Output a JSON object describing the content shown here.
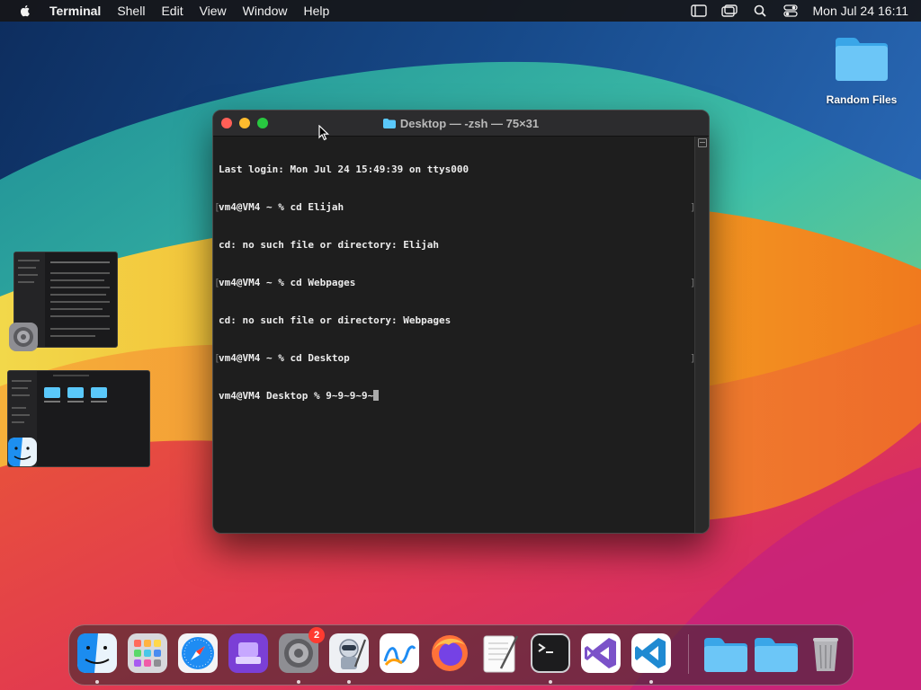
{
  "menubar": {
    "app_name": "Terminal",
    "items": [
      "Shell",
      "Edit",
      "View",
      "Window",
      "Help"
    ],
    "clock_date": "Mon Jul 24",
    "clock_time": "16:11"
  },
  "desktop": {
    "folder_label": "Random Files"
  },
  "terminal": {
    "title": "Desktop — -zsh — 75×31",
    "lines": [
      {
        "text": "Last login: Mon Jul 24 15:49:39 on ttys000",
        "marks": false
      },
      {
        "text": "vm4@VM4 ~ % cd Elijah",
        "marks": true
      },
      {
        "text": "cd: no such file or directory: Elijah",
        "marks": false
      },
      {
        "text": "vm4@VM4 ~ % cd Webpages",
        "marks": true
      },
      {
        "text": "cd: no such file or directory: Webpages",
        "marks": false
      },
      {
        "text": "vm4@VM4 ~ % cd Desktop",
        "marks": true
      }
    ],
    "prompt_line": "vm4@VM4 Desktop % 9~9~9~9~"
  },
  "dock": {
    "items": [
      {
        "name": "finder",
        "running": true
      },
      {
        "name": "launchpad",
        "running": false
      },
      {
        "name": "safari",
        "running": false
      },
      {
        "name": "podcasts-app",
        "running": false
      },
      {
        "name": "system-settings",
        "running": true,
        "badge": "2"
      },
      {
        "name": "automator",
        "running": true
      },
      {
        "name": "freeform",
        "running": false
      },
      {
        "name": "firefox",
        "running": false
      },
      {
        "name": "textedit",
        "running": false
      },
      {
        "name": "terminal",
        "running": true
      },
      {
        "name": "visual-studio",
        "running": false
      },
      {
        "name": "vscode",
        "running": true
      },
      {
        "name": "folder-1",
        "running": false
      },
      {
        "name": "folder-2",
        "running": false
      },
      {
        "name": "trash",
        "running": false
      }
    ]
  },
  "colors": {
    "menubar_bg": "#161618",
    "terminal_bg": "#1e1e1e",
    "traffic_close": "#ff5f57",
    "traffic_min": "#febc2e",
    "traffic_max": "#28c840",
    "folder_blue": "#5ac8fa",
    "badge_red": "#ff3b30"
  }
}
